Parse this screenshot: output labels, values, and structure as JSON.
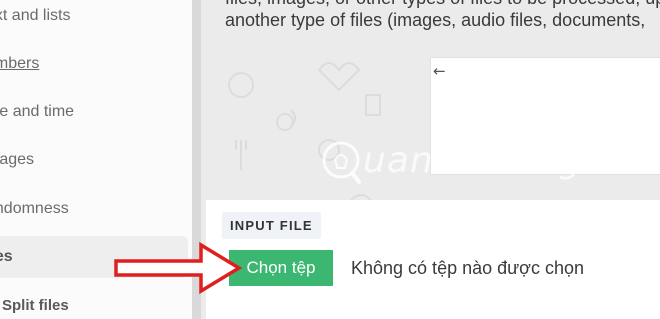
{
  "sidebar": {
    "items": [
      {
        "label": "ext and lists",
        "style": "normal"
      },
      {
        "label": "umbers",
        "style": "underline"
      },
      {
        "label": "ate and time",
        "style": "normal"
      },
      {
        "label": "mages",
        "style": "normal"
      },
      {
        "label": "andomness",
        "style": "normal"
      },
      {
        "label": "iles",
        "style": "active"
      },
      {
        "label": "Split files",
        "style": "bold"
      }
    ]
  },
  "main": {
    "description_line": "another type of files (images, audio files, documents,",
    "description_prev": "files, images, or other types of files to be processed, upload them here, or alternatively upload"
  },
  "watermark": {
    "text": "uantrimang"
  },
  "file_input": {
    "section_label": "INPUT FILE",
    "button_label": "Chọn tệp",
    "status_text": "Không có tệp nào được chọn"
  },
  "colors": {
    "button": "#3cb771",
    "annotation_arrow": "#e01e1e"
  },
  "icons": {
    "back": "arrow-left-icon",
    "watermark_logo": "bulb-icon",
    "annotation": "red-arrow-icon"
  }
}
